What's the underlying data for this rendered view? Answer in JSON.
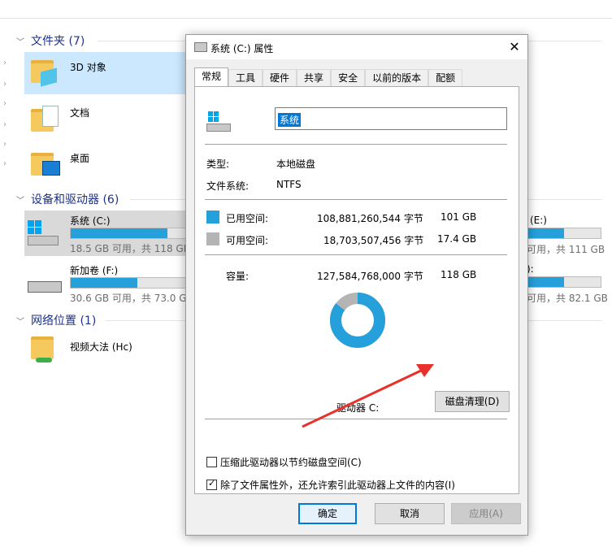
{
  "explorer": {
    "groups": [
      {
        "label": "文件夹 (7)"
      },
      {
        "label": "设备和驱动器 (6)"
      },
      {
        "label": "网络位置 (1)"
      }
    ],
    "folders": [
      "3D 对象",
      "文档",
      "桌面"
    ],
    "drives": [
      {
        "name": "系统 (C:)",
        "space": "18.5 GB 可用，共 118 GB",
        "used_fraction": 0.84
      },
      {
        "name": "新加卷 (F:)",
        "space": "30.6 GB 可用，共 73.0 GB",
        "used_fraction": 0.58
      }
    ],
    "right_drives": [
      {
        "name": "(E:)",
        "space": "可用，共 111 GB",
        "used_fraction": 0.5
      },
      {
        "name": "):",
        "space": "可用，共 82.1 GB",
        "used_fraction": 0.5
      }
    ],
    "network": [
      "视频大法 (Hc)"
    ]
  },
  "dialog": {
    "title": "系统 (C:) 属性",
    "tabs": [
      "常规",
      "工具",
      "硬件",
      "共享",
      "安全",
      "以前的版本",
      "配额"
    ],
    "drive_label_value": "系统",
    "type_label": "类型:",
    "type_value": "本地磁盘",
    "fs_label": "文件系统:",
    "fs_value": "NTFS",
    "used_label": "已用空间:",
    "used_bytes": "108,881,260,544 字节",
    "used_gb": "101 GB",
    "free_label": "可用空间:",
    "free_bytes": "18,703,507,456 字节",
    "free_gb": "17.4 GB",
    "capacity_label": "容量:",
    "capacity_bytes": "127,584,768,000 字节",
    "capacity_gb": "118 GB",
    "drive_caption": "驱动器 C:",
    "cleanup_button": "磁盘清理(D)",
    "compress_label": "压缩此驱动器以节约磁盘空间(C)",
    "compress_checked": false,
    "index_label": "除了文件属性外，还允许索引此驱动器上文件的内容(I)",
    "index_checked": true,
    "ok": "确定",
    "cancel": "取消",
    "apply": "应用(A)",
    "used_color": "#26a0da",
    "free_color": "#b4b4b4",
    "used_fraction": 0.8534
  }
}
